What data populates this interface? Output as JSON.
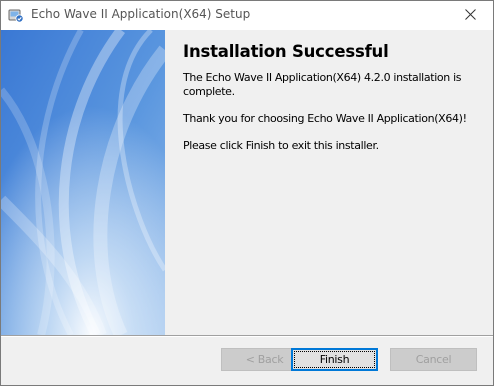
{
  "window": {
    "title": "Echo Wave II Application(X64) Setup",
    "icon": "installer-icon",
    "close_icon": "close-icon"
  },
  "content": {
    "heading": "Installation Successful",
    "paragraphs": [
      "The Echo Wave II Application(X64) 4.2.0 installation is complete.",
      "Thank you for choosing Echo Wave II Application(X64)!",
      "Please click Finish to exit this installer."
    ]
  },
  "buttons": {
    "back_label": "< Back",
    "finish_label": "Finish",
    "cancel_label": "Cancel"
  },
  "colors": {
    "banner_blue": "#3f7fd6",
    "banner_light": "#cfe3f7",
    "accent": "#0078d7"
  }
}
